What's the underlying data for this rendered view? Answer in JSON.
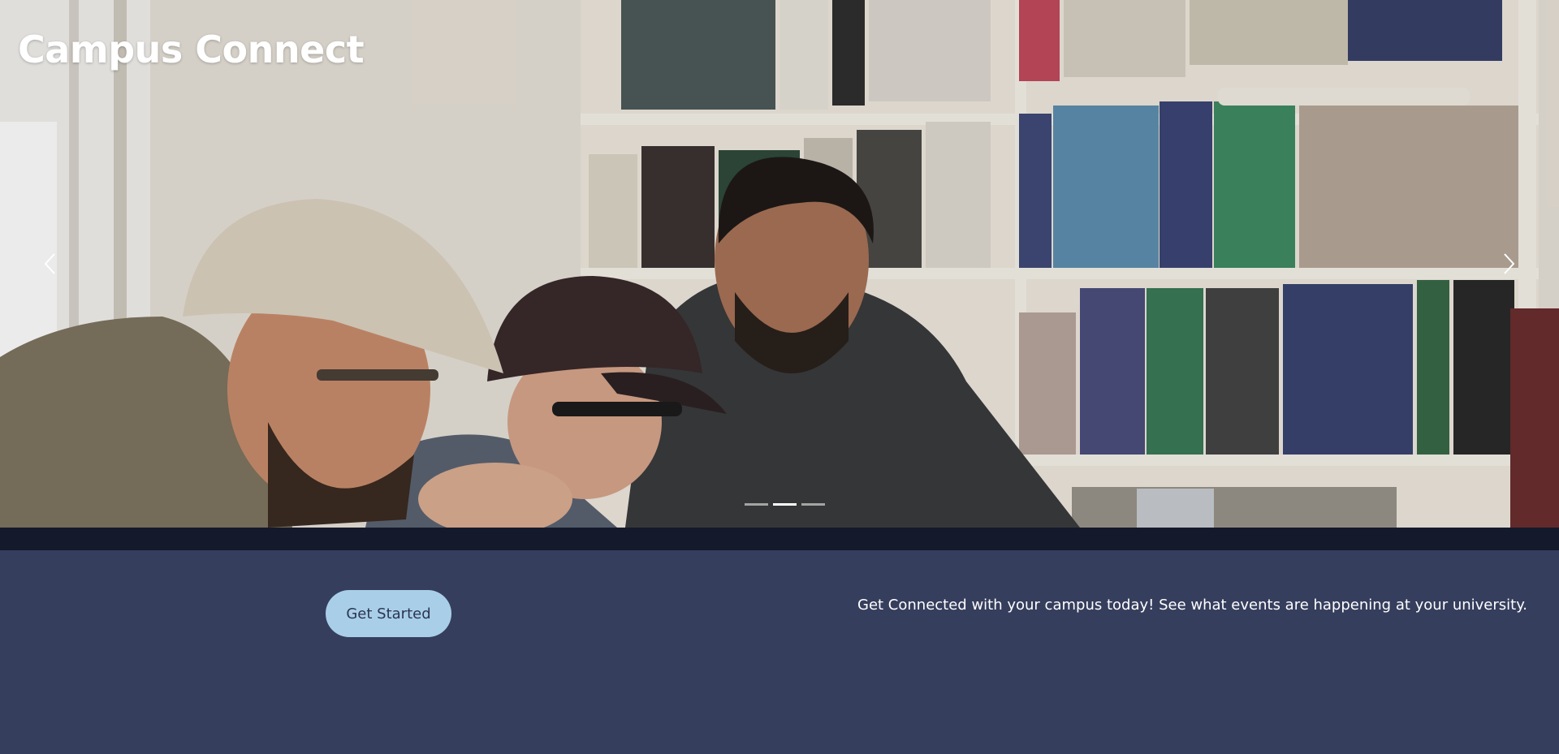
{
  "brand": {
    "title": "Campus Connect"
  },
  "carousel": {
    "prev_icon": "chevron-left-icon",
    "next_icon": "chevron-right-icon",
    "indicators": 3,
    "active_index": 1
  },
  "cta": {
    "button_label": "Get Started",
    "tagline": "Get Connected with your campus today! See what events are happening at your university."
  },
  "colors": {
    "section_bg": "#363e5d",
    "strip_bg": "#141a2c",
    "button_bg": "#a9cfe8",
    "button_text": "#2c3552",
    "text": "#ffffff"
  }
}
